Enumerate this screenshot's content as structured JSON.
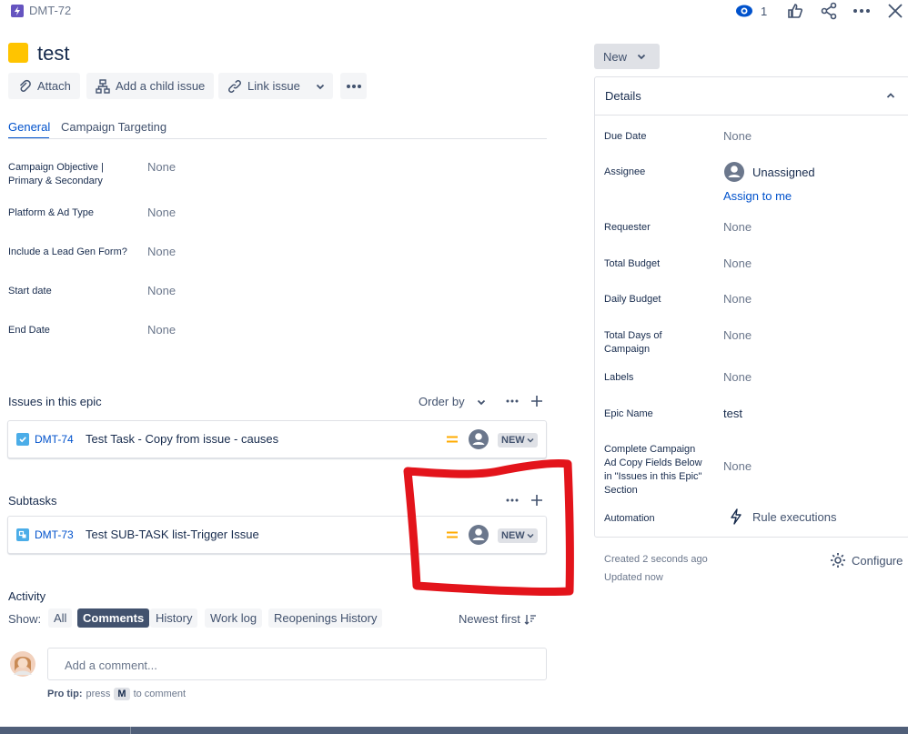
{
  "header": {
    "issue_key": "DMT-72",
    "watch_count": "1"
  },
  "issue": {
    "title": "test"
  },
  "toolbar": {
    "attach": "Attach",
    "add_child": "Add a child issue",
    "link_issue": "Link issue"
  },
  "status": {
    "label": "New"
  },
  "tabs": {
    "general": "General",
    "campaign": "Campaign Targeting"
  },
  "fields": {
    "f1_label": "Campaign Objective | Primary & Secondary",
    "f1_value": "None",
    "f2_label": "Platform & Ad Type",
    "f2_value": "None",
    "f3_label": "Include a Lead Gen Form?",
    "f3_value": "None",
    "f4_label": "Start date",
    "f4_value": "None",
    "f5_label": "End Date",
    "f5_value": "None"
  },
  "epic": {
    "heading": "Issues in this epic",
    "order_by": "Order by",
    "item_key": "DMT-74",
    "item_summary": "Test Task - Copy from issue - causes",
    "item_status": "NEW"
  },
  "subtasks": {
    "heading": "Subtasks",
    "item_key": "DMT-73",
    "item_summary": "Test SUB-TASK list-Trigger Issue",
    "item_status": "NEW"
  },
  "activity": {
    "heading": "Activity",
    "show": "Show:",
    "all": "All",
    "comments": "Comments",
    "history": "History",
    "worklog": "Work log",
    "reopenings": "Reopenings History",
    "sort": "Newest first",
    "comment_placeholder": "Add a comment...",
    "protip_bold": "Pro tip:",
    "protip_press": "press",
    "protip_key": "M",
    "protip_rest": "to comment"
  },
  "details": {
    "heading": "Details",
    "due_label": "Due Date",
    "due_value": "None",
    "assignee_label": "Assignee",
    "assignee_value": "Unassigned",
    "assign_me": "Assign to me",
    "requester_label": "Requester",
    "requester_value": "None",
    "total_budget_label": "Total Budget",
    "total_budget_value": "None",
    "daily_budget_label": "Daily Budget",
    "daily_budget_value": "None",
    "total_days_label": "Total Days of Campaign",
    "total_days_value": "None",
    "labels_label": "Labels",
    "labels_value": "None",
    "epic_name_label": "Epic Name",
    "epic_name_value": "test",
    "complete_label": "Complete Campaign Ad Copy Fields Below in \"Issues in this Epic\" Section",
    "complete_value": "None",
    "automation_label": "Automation",
    "automation_value": "Rule executions"
  },
  "footer": {
    "created": "Created 2 seconds ago",
    "updated": "Updated now",
    "configure": "Configure"
  },
  "colors": {
    "accent": "#0052cc",
    "epic": "#ffc400",
    "priority": "#ffab00",
    "annotation": "#e3141b"
  }
}
